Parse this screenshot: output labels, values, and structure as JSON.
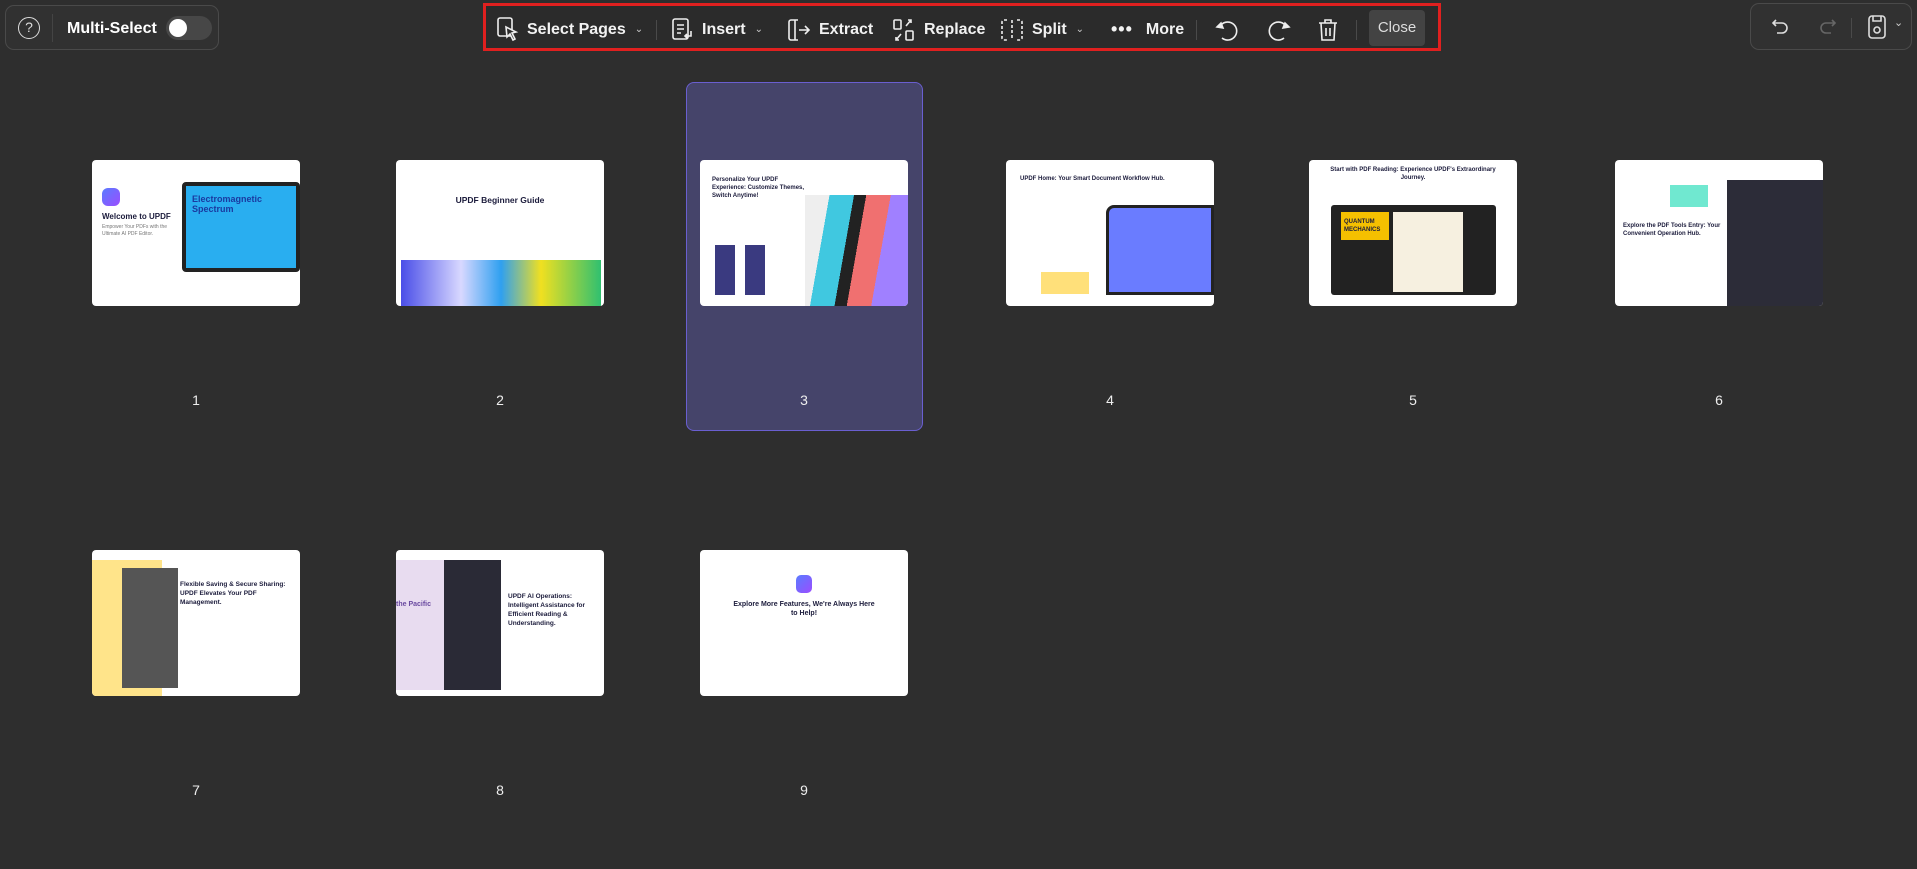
{
  "left_panel": {
    "help_icon": "question-circle-icon",
    "multi_select_label": "Multi-Select",
    "multi_select_on": false
  },
  "toolbar": {
    "select_pages": "Select Pages",
    "insert": "Insert",
    "extract": "Extract",
    "replace": "Replace",
    "split": "Split",
    "more": "More",
    "close": "Close",
    "highlight_color": "#e0201f"
  },
  "right_panel": {
    "undo_icon": "undo-icon",
    "redo_icon": "redo-icon",
    "save_icon": "save-icon"
  },
  "selected_page": 3,
  "pages": [
    {
      "number": "1",
      "title": "Welcome to UPDF",
      "subtitle": "Empower Your PDFs with the Ultimate AI PDF Editor.",
      "art": "Electromagnetic Spectrum"
    },
    {
      "number": "2",
      "title": "UPDF Beginner Guide"
    },
    {
      "number": "3",
      "title": "Personalize Your UPDF Experience: Customize Themes, Switch Anytime!"
    },
    {
      "number": "4",
      "title": "UPDF Home: Your Smart Document Workflow Hub."
    },
    {
      "number": "5",
      "title": "Start with PDF Reading: Experience UPDF's Extraordinary Journey.",
      "art": "QUANTUM MECHANICS"
    },
    {
      "number": "6",
      "title": "Explore the PDF Tools Entry: Your Convenient Operation Hub."
    },
    {
      "number": "7",
      "title": "Flexible Saving & Secure Sharing: UPDF Elevates Your PDF Management."
    },
    {
      "number": "8",
      "title": "UPDF AI Operations: Intelligent Assistance for Efficient Reading & Understanding.",
      "art": "the Pacific"
    },
    {
      "number": "9",
      "title": "Explore More Features, We're Always Here to Help!"
    }
  ]
}
